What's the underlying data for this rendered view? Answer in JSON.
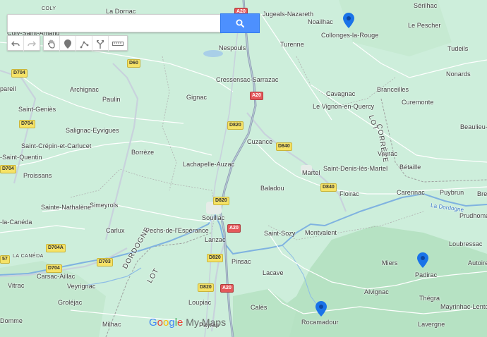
{
  "search": {
    "placeholder": "",
    "value": ""
  },
  "colors": {
    "pin": "#1a73e8",
    "search_button": "#4d90fe",
    "map_bg": "#cdeedb"
  },
  "icons": {
    "search": "search-icon",
    "undo": "undo-icon",
    "redo": "redo-icon",
    "pan": "hand-icon",
    "marker": "marker-icon",
    "line": "draw-line-icon",
    "directions": "route-icon",
    "measure": "ruler-icon"
  },
  "places": [
    {
      "key": "coly",
      "text": "COLY"
    },
    {
      "key": "ladornac",
      "text": "La Dornac"
    },
    {
      "key": "colysaintamand",
      "text": "Coly-Saint-Amand"
    },
    {
      "key": "argeals",
      "text": "Jugeals-Nazareth"
    },
    {
      "key": "serilhac",
      "text": "Sérilhac"
    },
    {
      "key": "noailhac",
      "text": "Noailhac"
    },
    {
      "key": "collonges",
      "text": "Collonges-la-Rouge"
    },
    {
      "key": "lepescher",
      "text": "Le Pescher"
    },
    {
      "key": "nespouls",
      "text": "Nespouls"
    },
    {
      "key": "turenne",
      "text": "Turenne"
    },
    {
      "key": "tudeils",
      "text": "Tudeils"
    },
    {
      "key": "nonards",
      "text": "Nonards"
    },
    {
      "key": "pareil",
      "text": "pareil"
    },
    {
      "key": "archignac",
      "text": "Archignac"
    },
    {
      "key": "cressensac",
      "text": "Cressensac-Sarrazac"
    },
    {
      "key": "cavagnac",
      "text": "Cavagnac"
    },
    {
      "key": "branceilles",
      "text": "Branceilles"
    },
    {
      "key": "paulin",
      "text": "Paulin"
    },
    {
      "key": "gignac",
      "text": "Gignac"
    },
    {
      "key": "vignon",
      "text": "Le Vignon-en-Quercy"
    },
    {
      "key": "curemonte",
      "text": "Curemonte"
    },
    {
      "key": "saintgenies",
      "text": "Saint-Geniès"
    },
    {
      "key": "beaulieu",
      "text": "Beaulieu-su"
    },
    {
      "key": "salignac",
      "text": "Salignac-Eyvigues"
    },
    {
      "key": "cuzance",
      "text": "Cuzance"
    },
    {
      "key": "saintcrepin",
      "text": "Saint-Crépin-et-Carlucet"
    },
    {
      "key": "borreze",
      "text": "Borrèze"
    },
    {
      "key": "vayrac",
      "text": "Vayrac"
    },
    {
      "key": "saintquentin",
      "text": "-Saint-Quentin"
    },
    {
      "key": "lachapelle",
      "text": "Lachapelle-Auzac"
    },
    {
      "key": "betaille",
      "text": "Bétaille"
    },
    {
      "key": "martel",
      "text": "Martel"
    },
    {
      "key": "saintdenis",
      "text": "Saint-Denis-lès-Martel"
    },
    {
      "key": "proissans",
      "text": "Proissans"
    },
    {
      "key": "baladou",
      "text": "Baladou"
    },
    {
      "key": "floirac",
      "text": "Floirac"
    },
    {
      "key": "carennac",
      "text": "Carennac"
    },
    {
      "key": "puybrun",
      "text": "Puybrun"
    },
    {
      "key": "bre",
      "text": "Bre"
    },
    {
      "key": "saintenathalene",
      "text": "Sainte-Nathalène"
    },
    {
      "key": "simeyrols",
      "text": "Simeyrols"
    },
    {
      "key": "prudhomat",
      "text": "Prudhoma"
    },
    {
      "key": "lacaneda",
      "text": "-la-Canéda"
    },
    {
      "key": "souillac",
      "text": "Souillac"
    },
    {
      "key": "carlux",
      "text": "Carlux"
    },
    {
      "key": "pechs",
      "text": "Pechs-de-l'Espérance"
    },
    {
      "key": "saintsozy",
      "text": "Saint-Sozy"
    },
    {
      "key": "montvalent",
      "text": "Montvalent"
    },
    {
      "key": "lanzac",
      "text": "Lanzac"
    },
    {
      "key": "loubressac",
      "text": "Loubressac"
    },
    {
      "key": "lacanedasmall",
      "text": "LA CANÉDA"
    },
    {
      "key": "miers",
      "text": "Miers"
    },
    {
      "key": "autoire",
      "text": "Autoire"
    },
    {
      "key": "pinsac",
      "text": "Pinsac"
    },
    {
      "key": "padirac",
      "text": "Padirac"
    },
    {
      "key": "carsac",
      "text": "Carsac-Aillac"
    },
    {
      "key": "lacave",
      "text": "Lacave"
    },
    {
      "key": "vitrac",
      "text": "Vitrac"
    },
    {
      "key": "veyrignac",
      "text": "Veyrignac"
    },
    {
      "key": "alvignac",
      "text": "Alvignac"
    },
    {
      "key": "thegra",
      "text": "Thégra"
    },
    {
      "key": "grolejac",
      "text": "Groléjac"
    },
    {
      "key": "mayrinhac",
      "text": "Mayrinhac-Lento"
    },
    {
      "key": "calès",
      "text": "Calès"
    },
    {
      "key": "loupiac",
      "text": "Loupiac"
    },
    {
      "key": "rocamadour",
      "text": "Rocamadour"
    },
    {
      "key": "domme",
      "text": "Domme"
    },
    {
      "key": "milhac",
      "text": "Milhac"
    },
    {
      "key": "payrac",
      "text": "Payrac"
    },
    {
      "key": "lavergne",
      "text": "Lavergne"
    }
  ],
  "regions": [
    {
      "key": "correze",
      "text": "CORRÈZE"
    },
    {
      "key": "lot_ne",
      "text": "LOT"
    },
    {
      "key": "dordogne",
      "text": "DORDOGNE"
    },
    {
      "key": "lot_sw",
      "text": "LOT"
    }
  ],
  "rivers": [
    {
      "key": "ladordogne",
      "text": "La Dordogne"
    }
  ],
  "road_shields": [
    {
      "key": "a20_top",
      "text": "A20",
      "kind": "a"
    },
    {
      "key": "d60",
      "text": "D60",
      "kind": "d"
    },
    {
      "key": "d704_1",
      "text": "D704",
      "kind": "d"
    },
    {
      "key": "a20_2",
      "text": "A20",
      "kind": "a"
    },
    {
      "key": "d704_2",
      "text": "D704",
      "kind": "d"
    },
    {
      "key": "d820_1",
      "text": "D820",
      "kind": "d"
    },
    {
      "key": "d840_1",
      "text": "D840",
      "kind": "d"
    },
    {
      "key": "d704_3",
      "text": "D704",
      "kind": "d"
    },
    {
      "key": "d840_2",
      "text": "D840",
      "kind": "d"
    },
    {
      "key": "d820_2",
      "text": "D820",
      "kind": "d"
    },
    {
      "key": "a20_3",
      "text": "A20",
      "kind": "a"
    },
    {
      "key": "d704a",
      "text": "D704A",
      "kind": "d"
    },
    {
      "key": "d703",
      "text": "D703",
      "kind": "d"
    },
    {
      "key": "d820_3",
      "text": "D820",
      "kind": "d"
    },
    {
      "key": "d704_4",
      "text": "D704",
      "kind": "d"
    },
    {
      "key": "d820_4",
      "text": "D820",
      "kind": "d"
    },
    {
      "key": "a20_4",
      "text": "A20",
      "kind": "a"
    },
    {
      "key": "n57",
      "text": "57",
      "kind": "d"
    }
  ],
  "pins": [
    {
      "key": "collonges",
      "label": "Collonges-la-Rouge marker"
    },
    {
      "key": "padirac",
      "label": "Padirac marker"
    },
    {
      "key": "rocamadour",
      "label": "Rocamadour marker"
    }
  ],
  "logo": {
    "g1": "G",
    "o1": "o",
    "o2": "o",
    "g2": "g",
    "l": "l",
    "e": "e",
    "mymaps": " My Maps"
  }
}
